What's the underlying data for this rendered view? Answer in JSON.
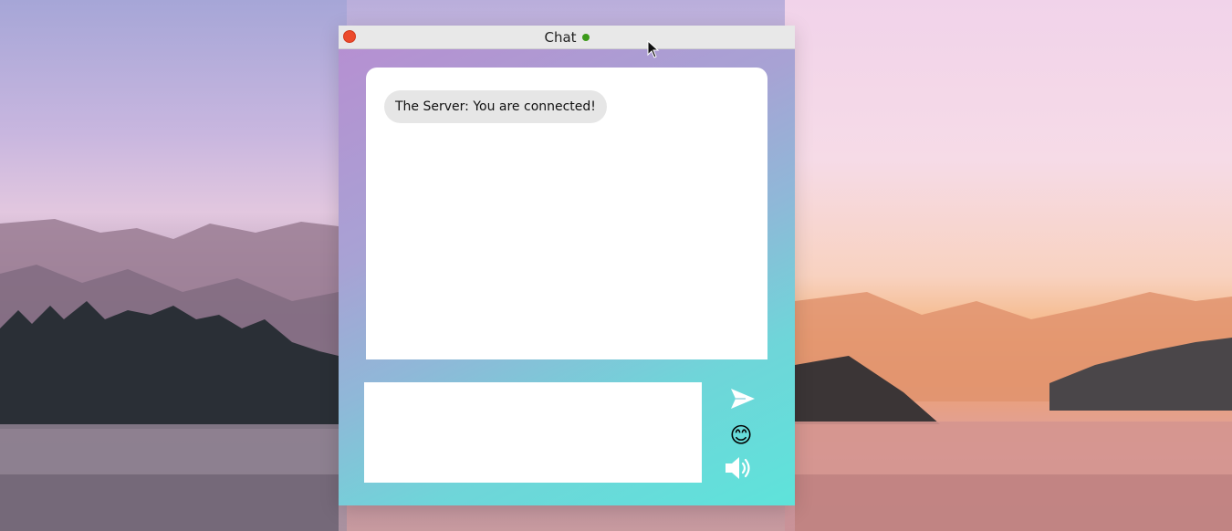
{
  "window": {
    "title": "Chat",
    "status_color": "#3c9a1a",
    "close_color": "#ec4a2c"
  },
  "messages": [
    {
      "text": "The Server: You are connected!"
    }
  ],
  "composer": {
    "value": "",
    "send_icon": "send-icon",
    "emoji_icon": "emoji-icon",
    "emoji_glyph": "😊",
    "sound_icon": "speaker-icon"
  }
}
